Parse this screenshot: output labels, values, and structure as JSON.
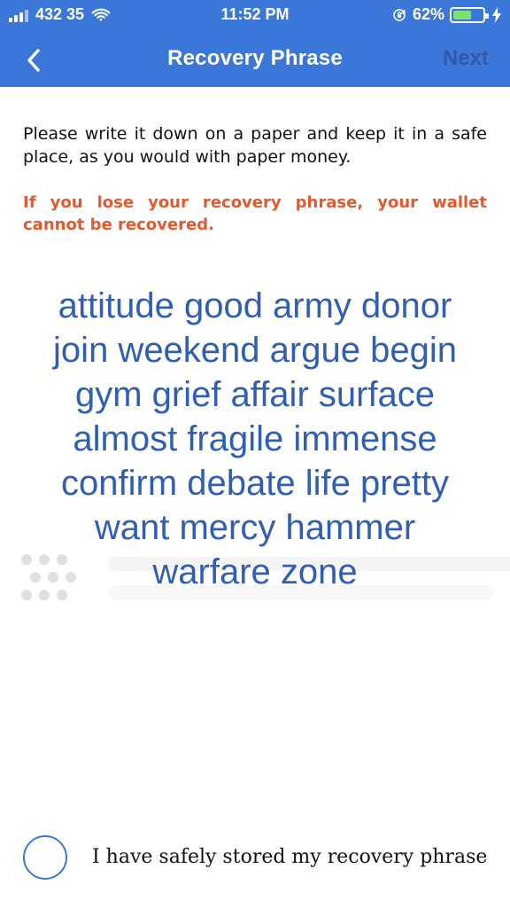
{
  "status": {
    "carrier": "432 35",
    "time": "11:52 PM",
    "battery_percent": "62%",
    "battery_fill": 0.62,
    "colors": {
      "primary": "#3b77d8",
      "battery_green": "#7ee06f"
    }
  },
  "nav": {
    "title": "Recovery Phrase",
    "next_label": "Next"
  },
  "content": {
    "instructions": "Please write it down on a paper and keep it in a safe place, as you would with paper money.",
    "warning": "If you lose your recovery phrase, your wallet cannot be recovered.",
    "phrase_lines": [
      "attitude good army donor",
      "join weekend argue begin",
      "gym grief affair surface",
      "almost fragile immense",
      "confirm debate life pretty",
      "want mercy hammer",
      "warfare zone"
    ],
    "confirm_text": "I have safely stored my recovery phrase"
  }
}
